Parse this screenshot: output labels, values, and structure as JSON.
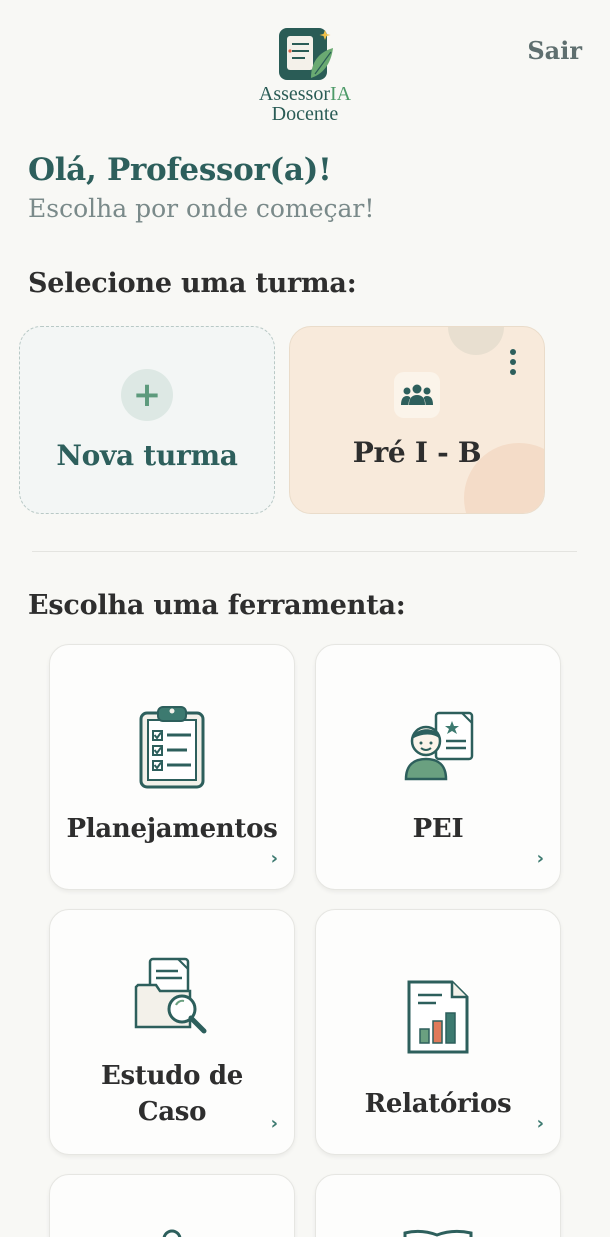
{
  "header": {
    "logo_line1_a": "Assessor",
    "logo_line1_b": "IA",
    "logo_line2": "Docente",
    "logout_label": "Sair"
  },
  "greeting": {
    "title": "Olá, Professor(a)!",
    "subtitle": "Escolha por onde começar!"
  },
  "classes": {
    "section_title": "Selecione uma turma:",
    "new_class_label": "Nova turma",
    "items": [
      {
        "label": "Pré I - B"
      }
    ]
  },
  "tools": {
    "section_title": "Escolha uma ferramenta:",
    "items": [
      {
        "label": "Planejamentos",
        "icon": "clipboard-checklist-icon"
      },
      {
        "label": "PEI",
        "icon": "student-document-icon"
      },
      {
        "label": "Estudo de Caso",
        "icon": "folder-search-icon"
      },
      {
        "label": "Relatórios",
        "icon": "report-chart-icon"
      }
    ]
  },
  "colors": {
    "primary": "#2d5f5c",
    "accent_green": "#5d9a7c",
    "class_card_bg": "#f8eadb",
    "background": "#f8f8f5"
  }
}
